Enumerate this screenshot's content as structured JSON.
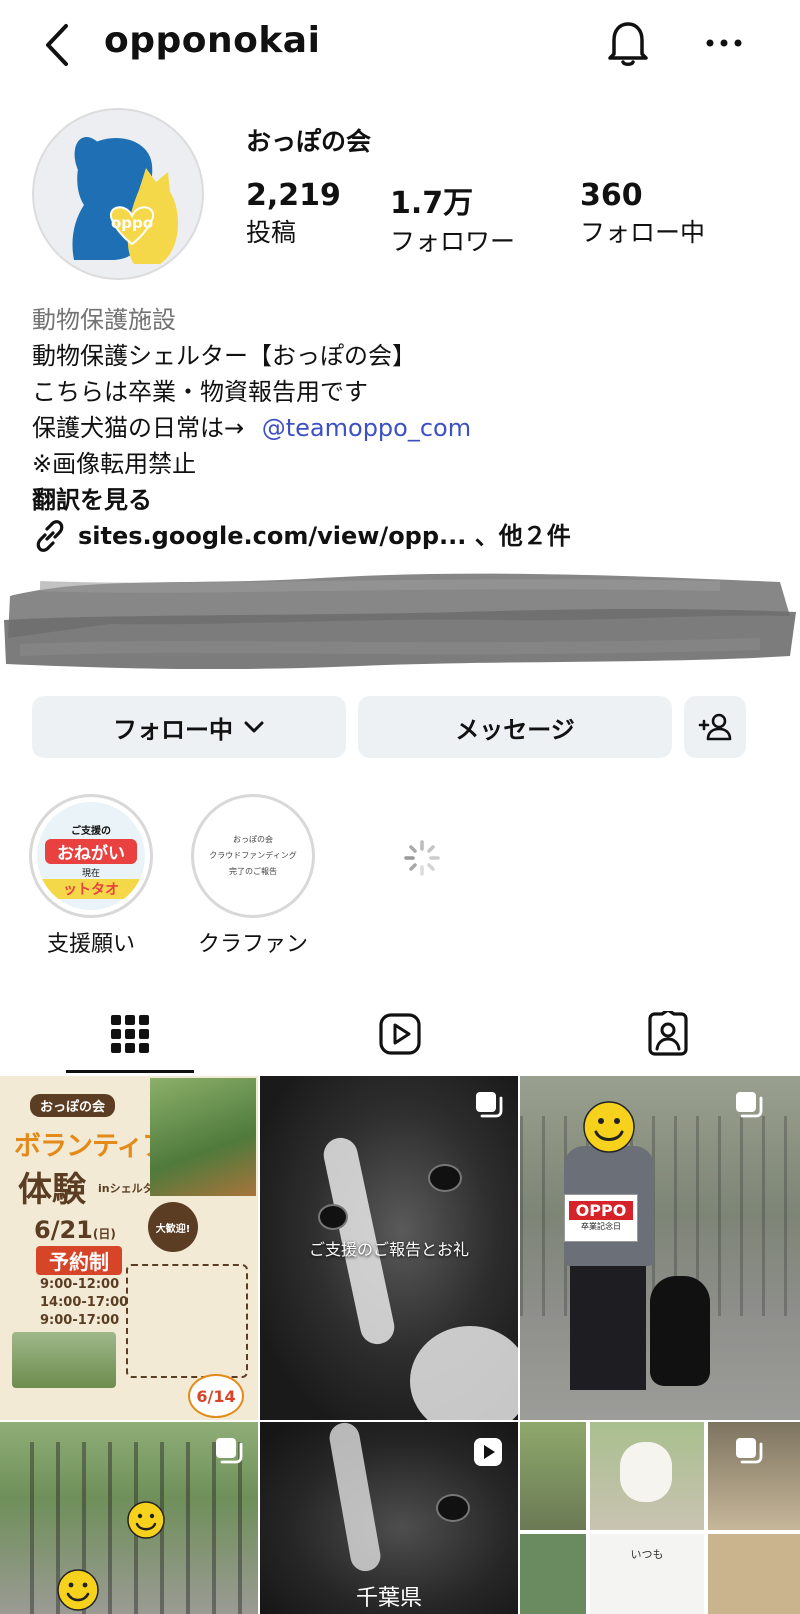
{
  "header": {
    "username": "opponokai"
  },
  "profile": {
    "display_name": "おっぽの会",
    "avatar_text": "oppo",
    "stats": [
      {
        "value": "2,219",
        "label": "投稿"
      },
      {
        "value": "1.7万",
        "label": "フォロワー"
      },
      {
        "value": "360",
        "label": "フォロー中"
      }
    ],
    "category": "動物保護施設",
    "bio_line1": "動物保護シェルター【おっぽの会】",
    "bio_line2": "こちらは卒業・物資報告用です",
    "bio_line3_prefix": "保護犬猫の日常は→",
    "bio_mention": "@teamoppo_com",
    "bio_line4": "※画像転用禁止",
    "translate": "翻訳を見る",
    "link_text": "sites.google.com/view/opp... 、他２件"
  },
  "actions": {
    "following": "フォロー中",
    "message": "メッセージ"
  },
  "highlights": [
    {
      "label": "支援願い",
      "cover_small": "ご支援の",
      "cover_big": "おねがい",
      "cover_sub": "現在",
      "cover_bottom": "ットタオ"
    },
    {
      "label": "クラファン",
      "cover_lines": [
        "おっぽの会",
        "クラウドファンディング",
        "完了のご報告"
      ]
    }
  ],
  "posts": {
    "volunteer": {
      "tag": "おっぽの会",
      "title1": "ボランティア",
      "title2": "体験",
      "title_suffix": "inシェルター",
      "date": "6/21",
      "date_day": "(日)",
      "reserve": "予約制",
      "times": [
        "9:00-12:00",
        "14:00-17:00",
        "9:00-17:00"
      ],
      "badge": "大歓迎!",
      "deadline": "6/14"
    },
    "report_caption": "ご支援のご報告とお礼",
    "sign_text": "OPPO",
    "sign_sub": "卒業記念日",
    "bottom_caption": "千葉県",
    "bottom_small_text": "いつも"
  },
  "colors": {
    "accent_link": "#3d51c4",
    "button_bg": "#eef1f4",
    "avatar_blue": "#1e6fb3",
    "avatar_yellow": "#f5d84a"
  }
}
